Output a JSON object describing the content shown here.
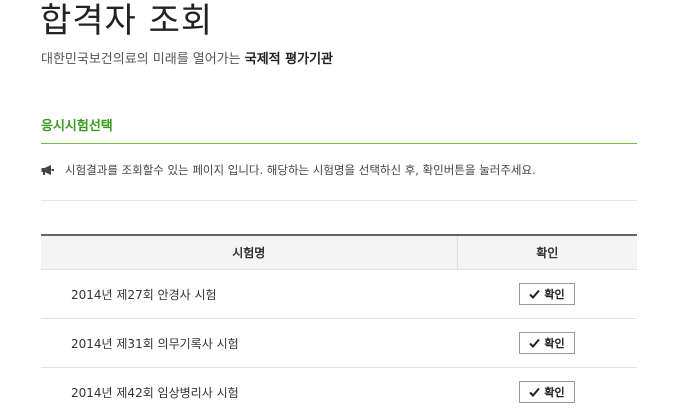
{
  "header": {
    "title": "합격자 조회",
    "subtitle_prefix": "대한민국보건의료의 미래를 열어가는",
    "subtitle_strong": "국제적 평가기관"
  },
  "section": {
    "title": "응시시험선택"
  },
  "notice": {
    "icon": "megaphone-icon",
    "text": "시험결과를 조회할수 있는 페이지 입니다. 해당하는 시험명을 선택하신 후, 확인버튼을 눌러주세요."
  },
  "table": {
    "columns": [
      "시험명",
      "확인"
    ],
    "rows": [
      {
        "name": "2014년 제27회 안경사 시험",
        "action_label": "확인"
      },
      {
        "name": "2014년 제31회 의무기록사 시험",
        "action_label": "확인"
      },
      {
        "name": "2014년 제42회 임상병리사 시험",
        "action_label": "확인"
      }
    ]
  },
  "colors": {
    "accent_green": "#3a9a1c",
    "rule_green": "#6cbf3f",
    "header_border": "#666666"
  }
}
